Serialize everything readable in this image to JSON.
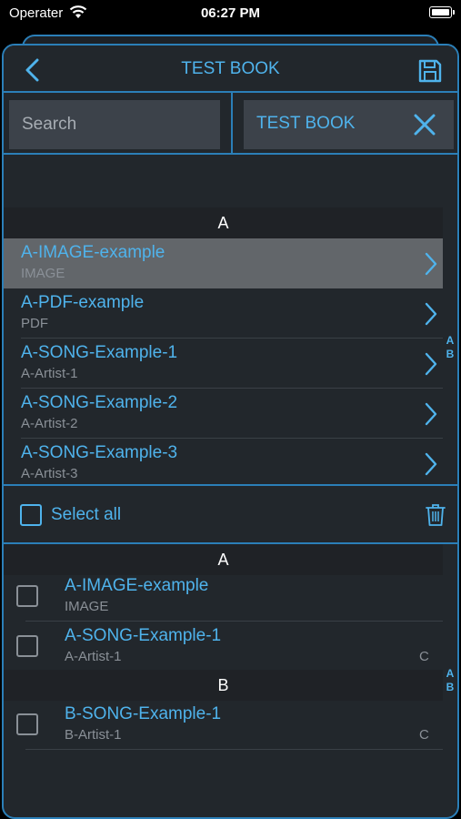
{
  "status_bar": {
    "carrier": "Operater",
    "time": "06:27 PM"
  },
  "header": {
    "title": "TEST BOOK"
  },
  "search": {
    "placeholder": "Search",
    "book_label": "TEST BOOK"
  },
  "list": {
    "section": "A",
    "items": [
      {
        "title": "A-IMAGE-example",
        "subtitle": "IMAGE",
        "selected": true
      },
      {
        "title": "A-PDF-example",
        "subtitle": "PDF"
      },
      {
        "title": "A-SONG-Example-1",
        "subtitle": "A-Artist-1"
      },
      {
        "title": "A-SONG-Example-2",
        "subtitle": "A-Artist-2"
      },
      {
        "title": "A-SONG-Example-3",
        "subtitle": "A-Artist-3"
      }
    ],
    "index": [
      "A",
      "B"
    ]
  },
  "select_all": {
    "label": "Select all"
  },
  "book_list": {
    "sections": [
      {
        "header": "A",
        "items": [
          {
            "title": "A-IMAGE-example",
            "subtitle": "IMAGE",
            "tag": ""
          },
          {
            "title": "A-SONG-Example-1",
            "subtitle": "A-Artist-1",
            "tag": "C"
          }
        ]
      },
      {
        "header": "B",
        "items": [
          {
            "title": "B-SONG-Example-1",
            "subtitle": "B-Artist-1",
            "tag": "C"
          }
        ]
      }
    ],
    "index": [
      "A",
      "B"
    ]
  },
  "colors": {
    "accent": "#4fb3ec",
    "border": "#2b7fb8",
    "background": "#22272c"
  },
  "icons": [
    "wifi-icon",
    "battery-icon",
    "back-chevron-icon",
    "save-icon",
    "close-icon",
    "chevron-right-icon",
    "checkbox-icon",
    "trash-icon"
  ]
}
